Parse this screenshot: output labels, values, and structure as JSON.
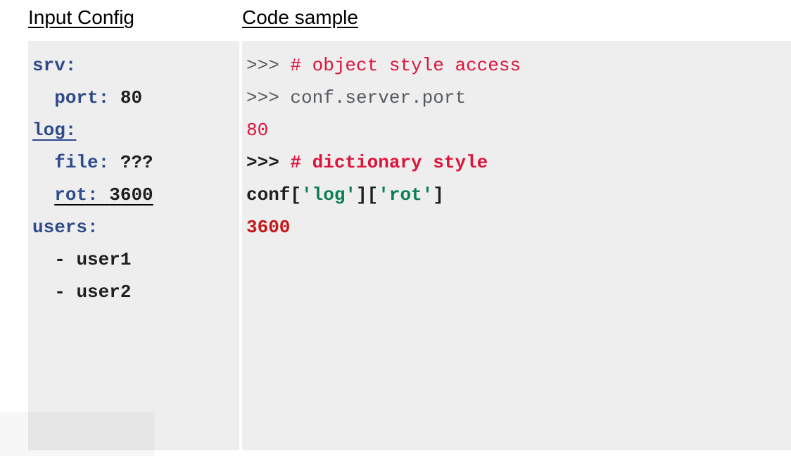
{
  "headings": {
    "left": "Input Config",
    "right": "Code sample"
  },
  "config": {
    "srv_key": "srv:",
    "port_key": "port:",
    "port_val": "80",
    "log_key": "log:",
    "file_key": "file:",
    "file_val": "???",
    "rot_key": "rot:",
    "rot_val": "3600",
    "users_key": "users:",
    "user1_dash": "- ",
    "user1": "user1",
    "user2_dash": "- ",
    "user2": "user2"
  },
  "code": {
    "p1": ">>> ",
    "c1": "# object style access",
    "p2": ">>> ",
    "l2": "conf.server.port",
    "o1": "80",
    "p3": ">>> ",
    "c2": "# dictionary style",
    "l3a": "conf[",
    "l3b": "'log'",
    "l3c": "][",
    "l3d": "'rot'",
    "l3e": "]",
    "o2": "3600"
  }
}
